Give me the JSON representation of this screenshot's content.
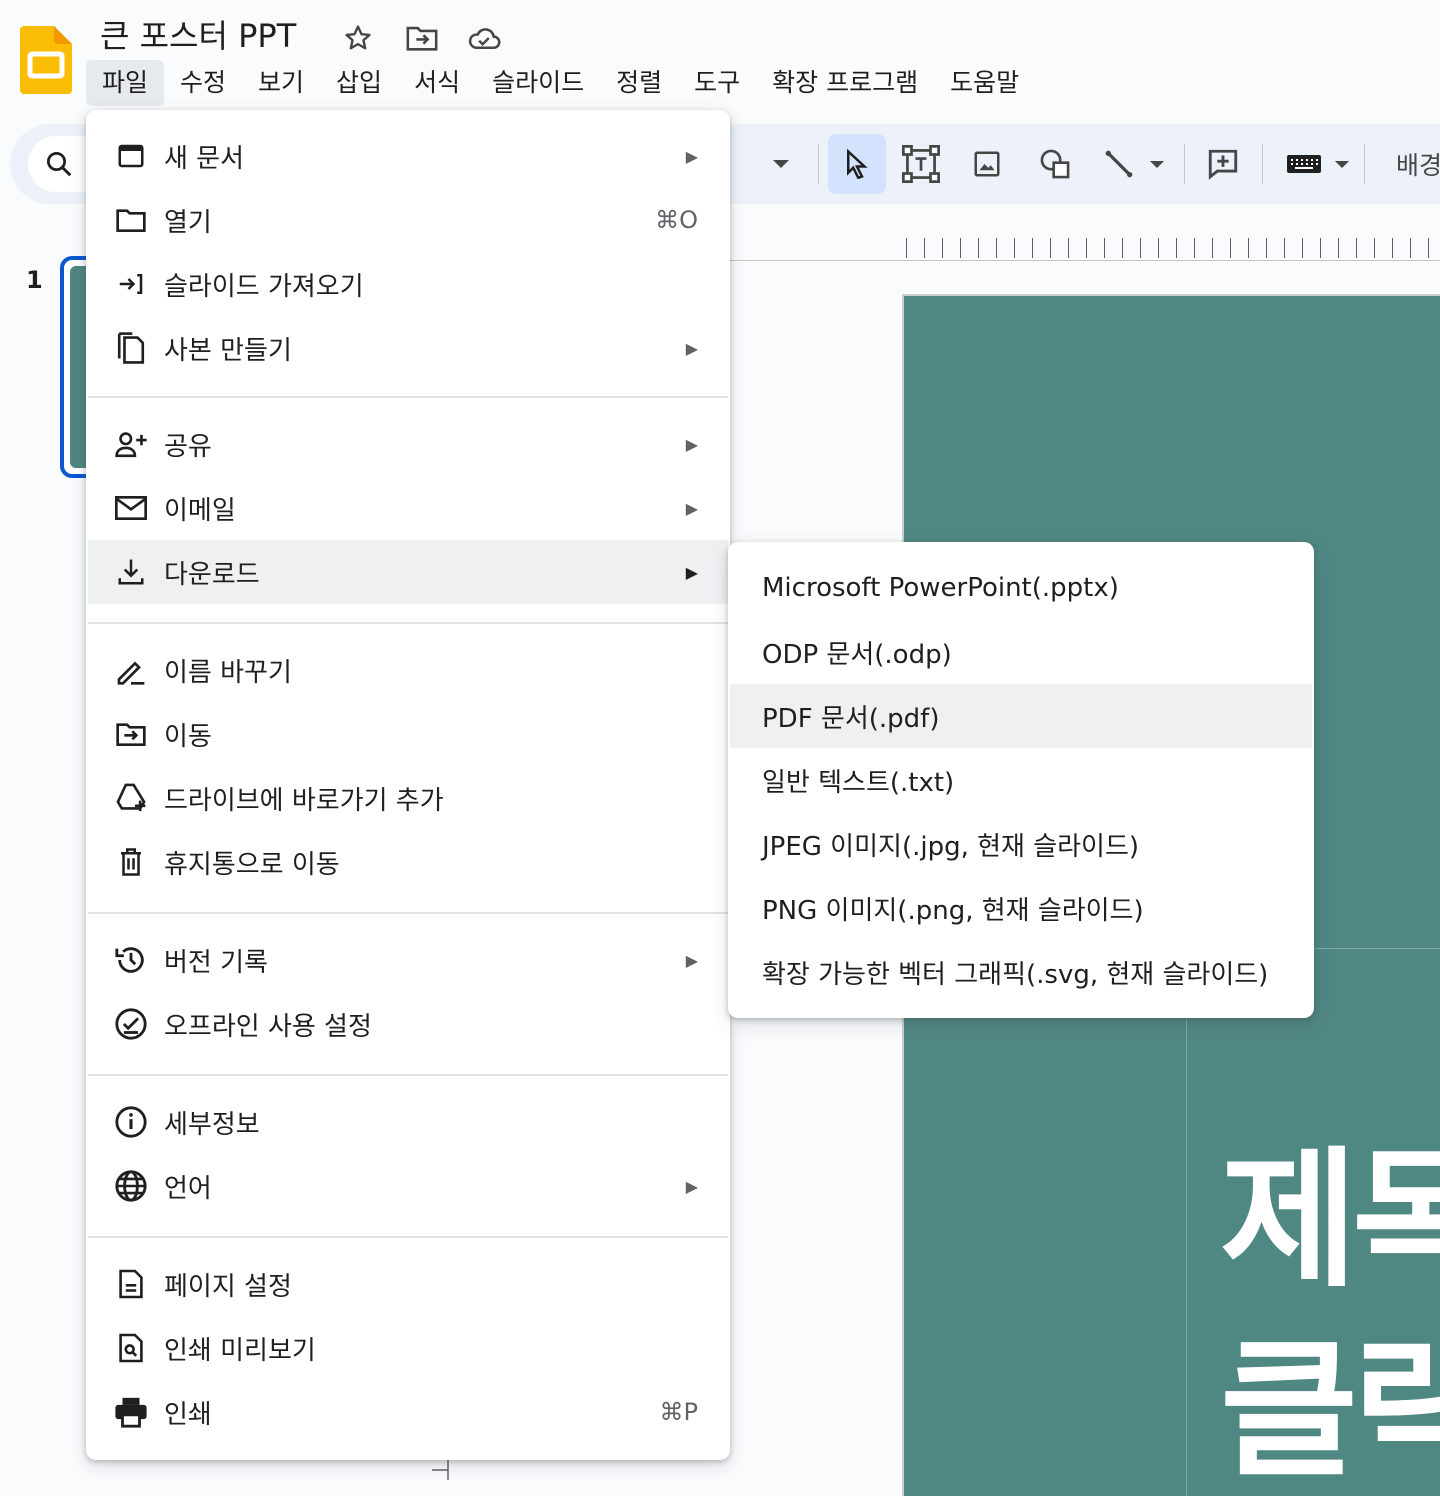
{
  "app": {
    "title": "큰 포스터 PPT",
    "brand_color": "#fbbc04"
  },
  "menubar": [
    {
      "label": "파일",
      "active": true
    },
    {
      "label": "수정"
    },
    {
      "label": "보기"
    },
    {
      "label": "삽입"
    },
    {
      "label": "서식"
    },
    {
      "label": "슬라이드"
    },
    {
      "label": "정렬"
    },
    {
      "label": "도구"
    },
    {
      "label": "확장 프로그램"
    },
    {
      "label": "도움말"
    }
  ],
  "toolbar": {
    "background_label": "배경"
  },
  "filmstrip": {
    "slide_number": "1"
  },
  "slide": {
    "line1": "제목",
    "line2": "클릭",
    "background_color": "#4f8783"
  },
  "file_menu": {
    "items": [
      {
        "label": "새 문서",
        "icon": "new-document-icon",
        "has_submenu": true
      },
      {
        "label": "열기",
        "icon": "folder-icon",
        "shortcut": "⌘O"
      },
      {
        "label": "슬라이드 가져오기",
        "icon": "import-icon"
      },
      {
        "label": "사본 만들기",
        "icon": "copy-icon",
        "has_submenu": true
      },
      {
        "label": "공유",
        "icon": "person-add-icon",
        "has_submenu": true
      },
      {
        "label": "이메일",
        "icon": "mail-icon",
        "has_submenu": true
      },
      {
        "label": "다운로드",
        "icon": "download-icon",
        "has_submenu": true,
        "highlighted": true
      },
      {
        "label": "이름 바꾸기",
        "icon": "rename-icon"
      },
      {
        "label": "이동",
        "icon": "move-folder-icon"
      },
      {
        "label": "드라이브에 바로가기 추가",
        "icon": "drive-shortcut-icon"
      },
      {
        "label": "휴지통으로 이동",
        "icon": "trash-icon"
      },
      {
        "label": "버전 기록",
        "icon": "history-icon",
        "has_submenu": true
      },
      {
        "label": "오프라인 사용 설정",
        "icon": "offline-icon"
      },
      {
        "label": "세부정보",
        "icon": "info-icon"
      },
      {
        "label": "언어",
        "icon": "globe-icon",
        "has_submenu": true
      },
      {
        "label": "페이지 설정",
        "icon": "page-setup-icon"
      },
      {
        "label": "인쇄 미리보기",
        "icon": "print-preview-icon"
      },
      {
        "label": "인쇄",
        "icon": "printer-icon",
        "shortcut": "⌘P"
      }
    ]
  },
  "download_submenu": {
    "items": [
      {
        "label": "Microsoft PowerPoint(.pptx)"
      },
      {
        "label": "ODP 문서(.odp)"
      },
      {
        "label": "PDF 문서(.pdf)",
        "highlighted": true
      },
      {
        "label": "일반 텍스트(.txt)"
      },
      {
        "label": "JPEG 이미지(.jpg, 현재 슬라이드)"
      },
      {
        "label": "PNG 이미지(.png, 현재 슬라이드)"
      },
      {
        "label": "확장 가능한 벡터 그래픽(.svg, 현재 슬라이드)"
      }
    ]
  }
}
